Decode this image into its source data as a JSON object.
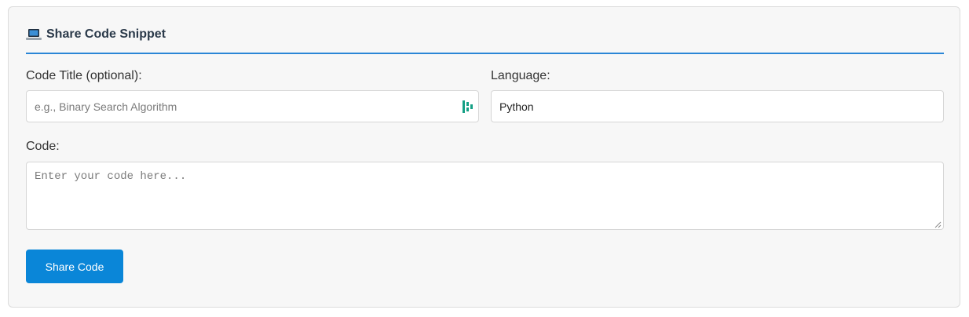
{
  "form": {
    "title": "Share Code Snippet",
    "icon": "laptop-icon",
    "title_field": {
      "label": "Code Title (optional):",
      "placeholder": "e.g., Binary Search Algorithm",
      "value": ""
    },
    "language_field": {
      "label": "Language:",
      "value": "Python"
    },
    "code_field": {
      "label": "Code:",
      "placeholder": "Enter your code here...",
      "value": ""
    },
    "submit_label": "Share Code"
  },
  "colors": {
    "accent": "#0a86d8",
    "header_rule": "#2a86d6",
    "card_bg": "#f7f7f7",
    "grammarly": "#15a085"
  }
}
